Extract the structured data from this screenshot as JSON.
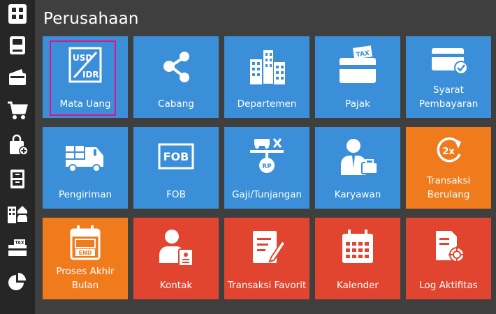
{
  "page": {
    "title": "Perusahaan"
  },
  "sidebar": {
    "items": [
      {
        "icon": "company-icon"
      },
      {
        "icon": "ledger-icon"
      },
      {
        "icon": "wallet-icon"
      },
      {
        "icon": "cart-icon"
      },
      {
        "icon": "shopping-bag-add-icon"
      },
      {
        "icon": "cabinet-icon"
      },
      {
        "icon": "building-car-icon"
      },
      {
        "icon": "tax-ticket-icon"
      },
      {
        "icon": "pie-chart-icon"
      }
    ]
  },
  "tiles": [
    {
      "label": "Mata Uang",
      "icon": "usd-idr-icon",
      "color": "#3b8fd9",
      "selected": true,
      "icon_text_top": "USD",
      "icon_text_bottom": "IDR"
    },
    {
      "label": "Cabang",
      "icon": "share-network-icon",
      "color": "#3b8fd9"
    },
    {
      "label": "Departemen",
      "icon": "buildings-icon",
      "color": "#3b8fd9"
    },
    {
      "label": "Pajak",
      "icon": "tax-icon",
      "color": "#3b8fd9",
      "icon_text": "TAX"
    },
    {
      "label": "Syarat\nPembayaran",
      "icon": "credit-card-check-icon",
      "color": "#3b8fd9"
    },
    {
      "label": "Pengiriman",
      "icon": "delivery-truck-icon",
      "color": "#3b8fd9"
    },
    {
      "label": "FOB",
      "icon": "fob-icon",
      "color": "#3b8fd9",
      "icon_text": "FOB"
    },
    {
      "label": "Gaji/Tunjangan",
      "icon": "salary-scale-icon",
      "color": "#3b8fd9",
      "icon_text": "RP"
    },
    {
      "label": "Karyawan",
      "icon": "employee-icon",
      "color": "#3b8fd9"
    },
    {
      "label": "Transaksi\nBerulang",
      "icon": "recurring-2x-icon",
      "color": "#f07b1d",
      "icon_text": "2x"
    },
    {
      "label": "Proses Akhir\nBulan",
      "icon": "calendar-end-icon",
      "color": "#f07b1d",
      "icon_text": "END"
    },
    {
      "label": "Kontak",
      "icon": "contact-icon",
      "color": "#e2452f"
    },
    {
      "label": "Transaksi Favorit",
      "icon": "edit-document-icon",
      "color": "#e2452f"
    },
    {
      "label": "Kalender",
      "icon": "calendar-icon",
      "color": "#e2452f"
    },
    {
      "label": "Log Aktifitas",
      "icon": "document-target-icon",
      "color": "#e2452f"
    }
  ]
}
